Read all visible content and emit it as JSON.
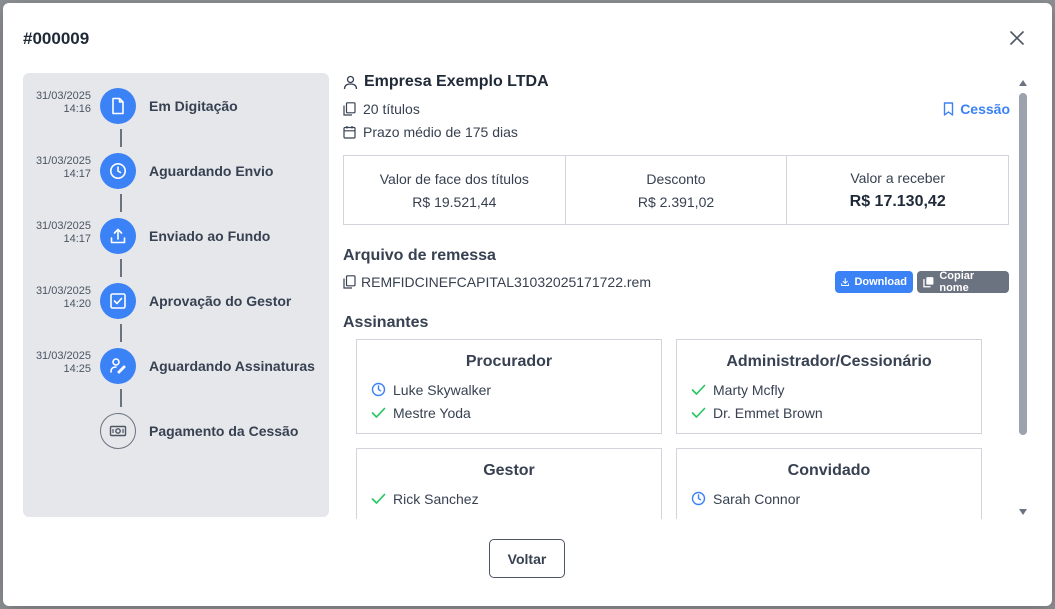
{
  "modal": {
    "title": "#000009",
    "close_icon": "close-icon"
  },
  "timeline": {
    "steps": [
      {
        "date": "31/03/2025",
        "time": "14:16",
        "label": "Em Digitação",
        "icon": "file-icon",
        "status": "done"
      },
      {
        "date": "31/03/2025",
        "time": "14:17",
        "label": "Aguardando Envio",
        "icon": "clock-icon",
        "status": "done"
      },
      {
        "date": "31/03/2025",
        "time": "14:17",
        "label": "Enviado ao Fundo",
        "icon": "upload-icon",
        "status": "done"
      },
      {
        "date": "31/03/2025",
        "time": "14:20",
        "label": "Aprovação do Gestor",
        "icon": "checkbox-icon",
        "status": "done"
      },
      {
        "date": "31/03/2025",
        "time": "14:25",
        "label": "Aguardando Assinaturas",
        "icon": "signature-icon",
        "status": "done"
      },
      {
        "date": "",
        "time": "",
        "label": "Pagamento da Cessão",
        "icon": "money-icon",
        "status": "pending"
      }
    ]
  },
  "details": {
    "company": "Empresa Exemplo LTDA",
    "titles_count": "20 títulos",
    "average_term": "Prazo médio de 175 dias",
    "cessao_label": "Cessão",
    "values": [
      {
        "label": "Valor de face dos títulos",
        "amount": "R$ 19.521,44"
      },
      {
        "label": "Desconto",
        "amount": "R$ 2.391,02"
      },
      {
        "label": "Valor a receber",
        "amount": "R$ 17.130,42"
      }
    ],
    "remittance": {
      "section_title": "Arquivo de remessa",
      "filename": "REMFIDCINEFCAPITAL31032025171722.rem",
      "download_label": "Download",
      "copy_label": "Copiar nome"
    },
    "signers": {
      "section_title": "Assinantes",
      "groups": [
        {
          "title": "Procurador",
          "members": [
            {
              "name": "Luke Skywalker",
              "status": "pending"
            },
            {
              "name": "Mestre Yoda",
              "status": "signed"
            }
          ]
        },
        {
          "title": "Administrador/Cessionário",
          "members": [
            {
              "name": "Marty Mcfly",
              "status": "signed"
            },
            {
              "name": "Dr. Emmet Brown",
              "status": "signed"
            }
          ]
        },
        {
          "title": "Gestor",
          "members": [
            {
              "name": "Rick Sanchez",
              "status": "signed"
            }
          ]
        },
        {
          "title": "Convidado",
          "members": [
            {
              "name": "Sarah Connor",
              "status": "pending"
            }
          ]
        }
      ]
    }
  },
  "footer": {
    "back_label": "Voltar"
  },
  "colors": {
    "accent": "#3b82f6",
    "success": "#22c55e",
    "timeline_bg": "#e5e7eb"
  }
}
